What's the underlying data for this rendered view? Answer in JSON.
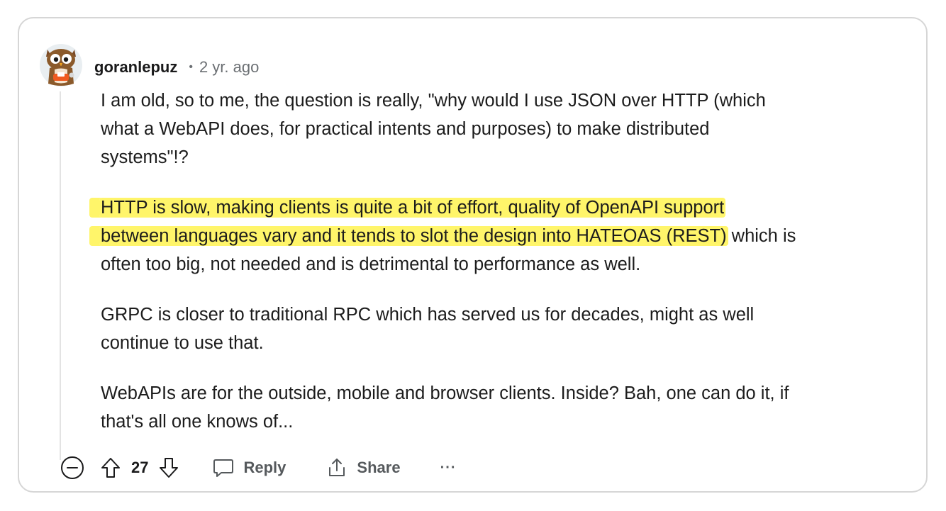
{
  "comment": {
    "author": "goranlepuz",
    "separator": "•",
    "timestamp": "2 yr. ago",
    "paragraphs": [
      {
        "lines": [
          "I am old, so to me, the question is really, \"why would I use JSON over HTTP (which",
          "what a WebAPI does, for practical intents and purposes) to make distributed",
          "systems\"!?"
        ]
      },
      {
        "highlighted_line_1": "HTTP is slow, making clients is quite a bit of effort, quality of OpenAPI support",
        "highlighted_line_2": "between languages vary and it tends to slot the design into HATEOAS (REST)",
        "line_2_rest": " which is",
        "line_3": "often too big, not needed and is detrimental to performance as well."
      },
      {
        "lines": [
          "GRPC is closer to traditional RPC which has served us for decades, might as well",
          "continue to use that."
        ]
      },
      {
        "lines": [
          "WebAPIs are for the outside, mobile and browser clients. Inside? Bah, one can do it, if",
          "that's all one knows of..."
        ]
      }
    ],
    "highlight_color": "#fff56a"
  },
  "actions": {
    "vote_count": "27",
    "reply_label": "Reply",
    "share_label": "Share",
    "more_label": "···",
    "icons": {
      "collapse": "minus-circle-icon",
      "upvote": "arrow-up-icon",
      "downvote": "arrow-down-icon",
      "reply": "speech-bubble-icon",
      "share": "share-upload-icon"
    }
  }
}
